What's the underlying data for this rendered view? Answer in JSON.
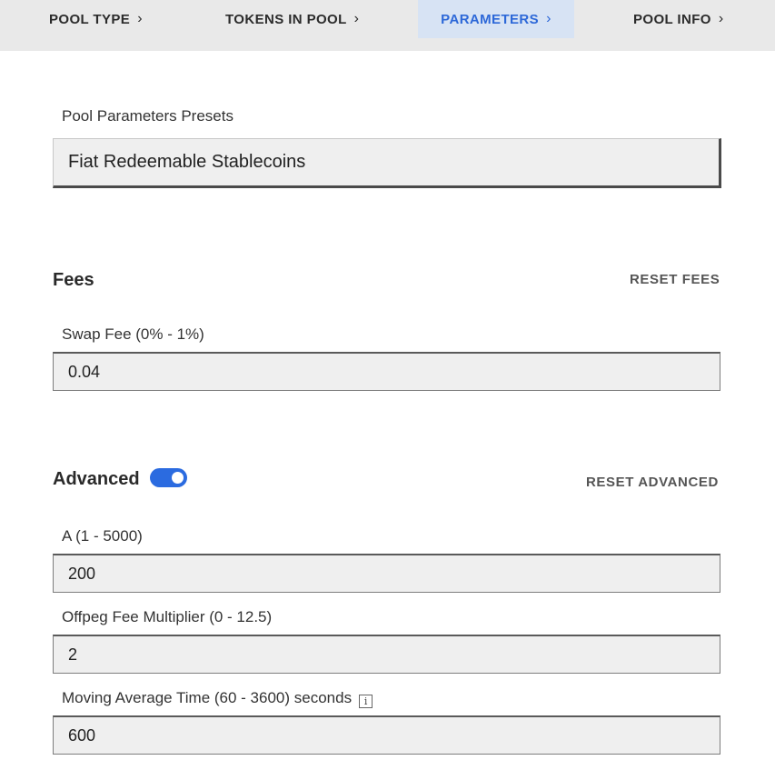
{
  "tabs": [
    {
      "label": "POOL TYPE",
      "chevron": "›"
    },
    {
      "label": "TOKENS IN POOL",
      "chevron": "›"
    },
    {
      "label": "PARAMETERS",
      "chevron": "›"
    },
    {
      "label": "POOL INFO",
      "chevron": "›"
    }
  ],
  "active_tab": "PARAMETERS",
  "colors": {
    "accent": "#2d68d8",
    "toggle_on": "#2b6be0",
    "tab_bar": "#e9e9e9",
    "active_tab_bg": "#d7e3f4"
  },
  "presets": {
    "label": "Pool Parameters Presets",
    "value": "Fiat Redeemable Stablecoins"
  },
  "fees": {
    "title": "Fees",
    "reset_label": "RESET FEES",
    "swap_fee_label": "Swap Fee (0% - 1%)",
    "swap_fee_value": "0.04"
  },
  "advanced": {
    "title": "Advanced",
    "toggle_on": true,
    "reset_label": "RESET ADVANCED",
    "a_label": "A (1 - 5000)",
    "a_value": "200",
    "offpeg_label": "Offpeg Fee Multiplier (0 - 12.5)",
    "offpeg_value": "2",
    "ma_label": "Moving Average Time (60 - 3600) seconds",
    "ma_value": "600",
    "info_icon": "info-icon",
    "info_glyph": "i"
  }
}
